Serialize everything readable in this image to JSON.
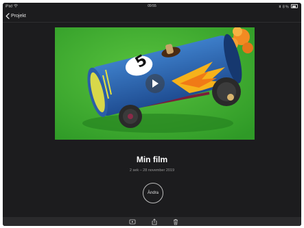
{
  "status_bar": {
    "carrier": "iPad",
    "time": "09:55",
    "battery": "8 %"
  },
  "nav": {
    "back_label": "Projekt"
  },
  "project": {
    "title": "Min film",
    "subtitle": "2 sek – 28 november 2019"
  },
  "edit_button": {
    "label": "Ändra"
  },
  "video": {
    "sticker_number": "5"
  },
  "icons": {
    "back": "chevron-left-icon",
    "play": "play-icon",
    "wifi": "wifi-icon",
    "bluetooth": "bluetooth-icon",
    "battery": "battery-icon",
    "toolbar": [
      "play-preview-icon",
      "share-icon",
      "trash-icon"
    ]
  },
  "colors": {
    "background": "#1c1c1e",
    "toolbar": "#2a2a2c",
    "title": "#ffffff",
    "subtitle": "#9a9a9a",
    "video_backdrop": "#3fae2f"
  }
}
